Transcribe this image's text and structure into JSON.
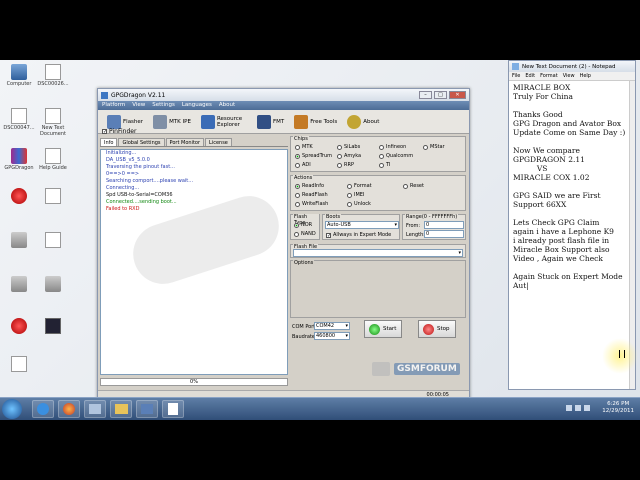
{
  "desktop": {
    "icons": [
      {
        "label": "Computer",
        "kind": "pc"
      },
      {
        "label": "DSC00026...",
        "kind": "doc"
      },
      {
        "label": "DSC00047...",
        "kind": "doc"
      },
      {
        "label": "New Text Document",
        "kind": "doc"
      },
      {
        "label": "GPGDragon",
        "kind": "rar"
      },
      {
        "label": "Help Guide",
        "kind": "doc"
      },
      {
        "label": "",
        "kind": "red"
      },
      {
        "label": "",
        "kind": "doc"
      },
      {
        "label": "",
        "kind": "gray"
      },
      {
        "label": "",
        "kind": "doc"
      },
      {
        "label": "",
        "kind": "gray"
      },
      {
        "label": "",
        "kind": "gray"
      },
      {
        "label": "",
        "kind": "red"
      },
      {
        "label": "",
        "kind": "dark"
      },
      {
        "label": "",
        "kind": "doc"
      }
    ]
  },
  "app": {
    "title": "GPGDragon V2.11",
    "menu": [
      "Platform",
      "View",
      "Settings",
      "Languages",
      "About"
    ],
    "toolbar": [
      {
        "label": "Flasher",
        "color": "#5a7fb7"
      },
      {
        "label": "MTK IPE",
        "color": "#7f8fa6"
      },
      {
        "label": "Resource Explorer",
        "color": "#3b6cb6"
      },
      {
        "label": "FMT",
        "color": "#314f84"
      },
      {
        "label": "Free Tools",
        "color": "#c47a25"
      },
      {
        "label": "About",
        "color": "#c2a533"
      }
    ],
    "pinfinder_label": "PinFinder",
    "tabs": [
      "Info",
      "Global Settings",
      "Port Monitor",
      "License"
    ],
    "log": [
      {
        "text": "Initializing...",
        "color": "#2a3fb0"
      },
      {
        "text": "DA_USB_v5_5.0.0",
        "color": "#2a3fb0"
      },
      {
        "text": "Traversing the pinout fast...",
        "color": "#2a3fb0"
      },
      {
        "text": "0==>0 ==>",
        "color": "#2a3fb0"
      },
      {
        "text": "Searching comport....please wait...",
        "color": "#2a3fb0"
      },
      {
        "text": "Connecting...",
        "color": "#2a3fb0"
      },
      {
        "text": "Spd USB-to-Serial=COM36",
        "color": "#111111"
      },
      {
        "text": "Connected....sending boot...",
        "color": "#118811"
      },
      {
        "text": "Failed to RXD",
        "color": "#cc1111"
      }
    ],
    "progress": "0%",
    "chips": {
      "label": "Chips",
      "options": [
        "MTK",
        "SpreadTrum",
        "ADI",
        "SiLabs",
        "Amyka",
        "RRP",
        "Infineon",
        "Qualcomm",
        "TI",
        "MStar"
      ],
      "selected": "SpreadTrum"
    },
    "actions": {
      "label": "Actions",
      "options": [
        "ReadInfo",
        "ReadFlash",
        "WriteFlash",
        "Format",
        "IMEI",
        "Unlock",
        "Reset"
      ],
      "selected": "ReadInfo"
    },
    "flash_type": {
      "label": "Flash Type",
      "options": [
        "NOR",
        "NAND"
      ],
      "selected": "NOR"
    },
    "boots": {
      "label": "Boots",
      "value": "Auto-USB",
      "expert_label": "Allways in Expert Mode"
    },
    "range": {
      "label": "Range(0 - FFFFFFFh)",
      "from_label": "From:",
      "from": "0",
      "length_label": "Length:",
      "length": "0"
    },
    "flash_file_label": "Flash File",
    "options_label": "Options",
    "comport_label": "COM Port",
    "comport": "COM42",
    "baud_label": "Baudrate",
    "baud": "460800",
    "start_label": "Start",
    "stop_label": "Stop",
    "status_time": "00:00:05"
  },
  "notepad": {
    "title": "New Text Document (2) - Notepad",
    "menu": [
      "File",
      "Edit",
      "Format",
      "View",
      "Help"
    ],
    "lines": [
      "MIRACLE BOX",
      "Truly For China",
      "",
      "Thanks Good",
      "GPG Dragon and Avator Box",
      "Update Come on Same Day :)",
      "",
      "Now We compare",
      "GPGDRAGON 2.11",
      "          VS",
      "MIRACLE COX 1.02",
      "",
      "GPG SAID we are First",
      "Support 66XX",
      "",
      "Lets Check GPG Claim",
      "again i have a Lephone K9",
      "i already post flash file in",
      "Miracle Box Support also",
      "Video , Again we Check",
      "",
      "Again Stuck on Expert Mode",
      "Aut|"
    ]
  },
  "watermark": {
    "text": "GSMFORUM"
  },
  "taskbar": {
    "time": "6:26 PM",
    "date": "12/29/2011"
  }
}
